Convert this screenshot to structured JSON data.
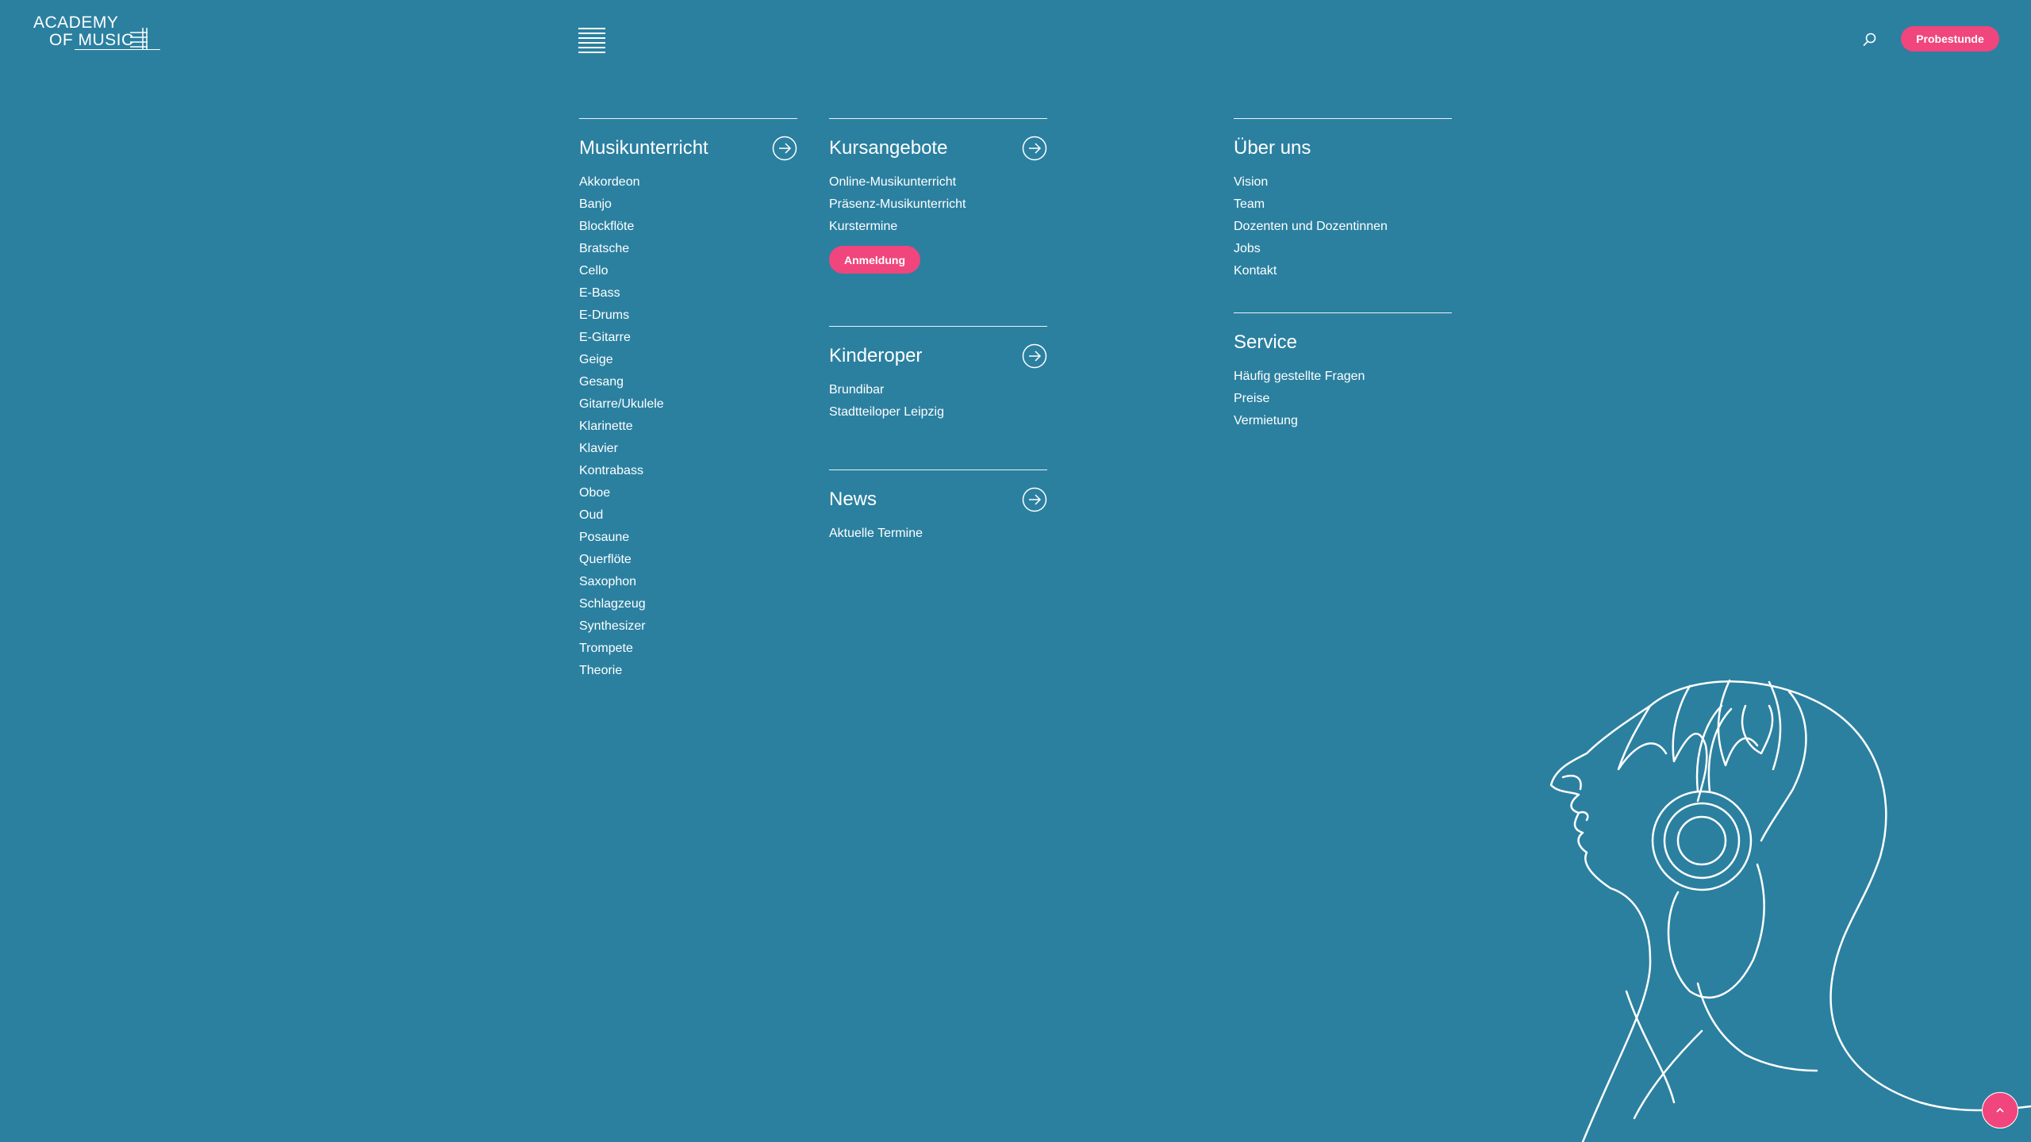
{
  "header": {
    "logo_line1": "ACADEMY",
    "logo_line2": "OF MUSIC",
    "menu_icon": "hamburger-menu-icon",
    "search_icon": "search-icon",
    "cta_label": "Probestunde"
  },
  "menu": {
    "musikunterricht": {
      "title": "Musikunterricht",
      "items": [
        "Akkordeon",
        "Banjo",
        "Blockflöte",
        "Bratsche",
        "Cello",
        "E-Bass",
        "E-Drums",
        "E-Gitarre",
        "Geige",
        "Gesang",
        "Gitarre/Ukulele",
        "Klarinette",
        "Klavier",
        "Kontrabass",
        "Oboe",
        "Oud",
        "Posaune",
        "Querflöte",
        "Saxophon",
        "Schlagzeug",
        "Synthesizer",
        "Trompete",
        "Theorie"
      ]
    },
    "kursangebote": {
      "title": "Kursangebote",
      "items": [
        "Online-Musikunterricht",
        "Präsenz-Musikunterricht",
        "Kurstermine"
      ],
      "button": "Anmeldung"
    },
    "kinderoper": {
      "title": "Kinderoper",
      "items": [
        "Brundibar",
        "Stadtteiloper Leipzig"
      ]
    },
    "news": {
      "title": "News",
      "items": [
        "Aktuelle Termine"
      ]
    },
    "ueber_uns": {
      "title": "Über uns",
      "items": [
        "Vision",
        "Team",
        "Dozenten und Dozentinnen",
        "Jobs",
        "Kontakt"
      ]
    },
    "service": {
      "title": "Service",
      "items": [
        "Häufig gestellte Fragen",
        "Preise",
        "Vermietung"
      ]
    }
  },
  "colors": {
    "background": "#2b80a0",
    "accent": "#f0457d",
    "text": "#ffffff"
  },
  "scroll_top_icon": "chevron-up-icon"
}
